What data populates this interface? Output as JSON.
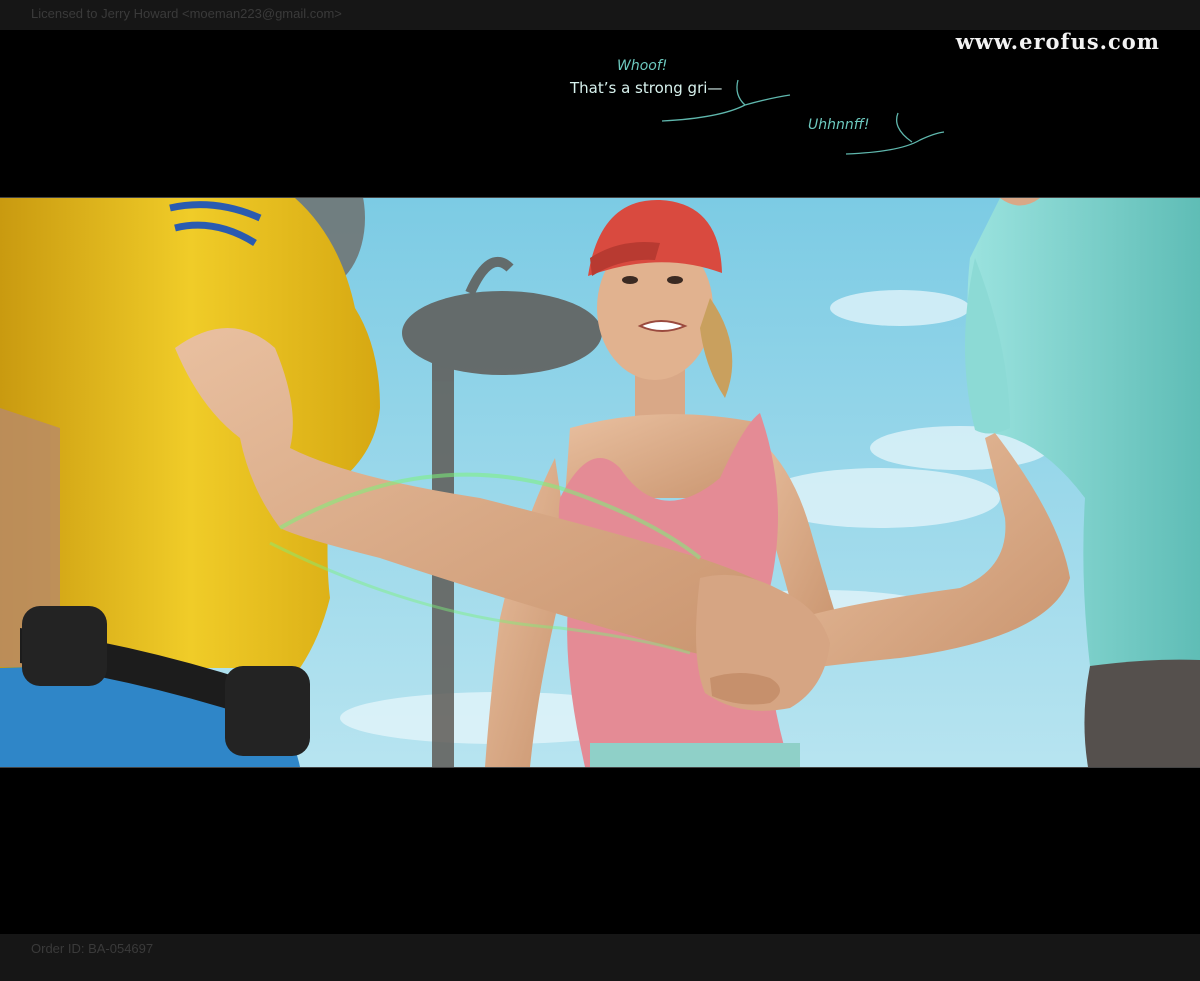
{
  "header": {
    "license_text": "Licensed to Jerry Howard <moeman223@gmail.com>",
    "watermark": "www.erofus.com"
  },
  "dialogue": {
    "line_1": "Whoof!",
    "line_2": "That’s a strong gri—",
    "line_3": "Uhhnnff!"
  },
  "footer": {
    "order_text": "Order ID: BA-054697"
  },
  "colors": {
    "background": "#000000",
    "strip": "#161616",
    "dialogue_accent": "#6dc9bf",
    "sky": "#8fd2e8",
    "yellow_shirt": "#e8c21a",
    "pink_top": "#e48b95",
    "teal_shirt": "#7fd4cf"
  }
}
